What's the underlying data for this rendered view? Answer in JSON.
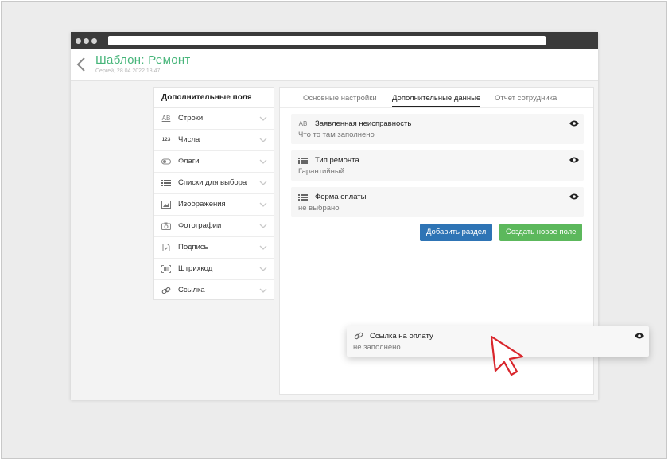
{
  "app": {
    "title": "Шаблон: Ремонт",
    "subtitle": "Сергей, 28.04.2022 18:47"
  },
  "fields": {
    "title": "Дополнительные поля",
    "items": [
      {
        "label": "Строки",
        "icon": "text-ab-icon",
        "glyph": "AB"
      },
      {
        "label": "Числа",
        "icon": "numbers-icon",
        "glyph": "123"
      },
      {
        "label": "Флаги",
        "icon": "toggle-icon",
        "glyph": ""
      },
      {
        "label": "Списки для выбора",
        "icon": "list-icon",
        "glyph": ""
      },
      {
        "label": "Изображения",
        "icon": "image-icon",
        "glyph": ""
      },
      {
        "label": "Фотографии",
        "icon": "camera-icon",
        "glyph": ""
      },
      {
        "label": "Подпись",
        "icon": "signature-icon",
        "glyph": ""
      },
      {
        "label": "Штрихкод",
        "icon": "barcode-icon",
        "glyph": ""
      },
      {
        "label": "Ссылка",
        "icon": "link-icon",
        "glyph": ""
      }
    ]
  },
  "tabs": [
    {
      "label": "Основные настройки",
      "active": false
    },
    {
      "label": "Дополнительные данные",
      "active": true
    },
    {
      "label": "Отчет сотрудника",
      "active": false
    }
  ],
  "cards": [
    {
      "title": "Заявленная неисправность",
      "value": "Что то там заполнено",
      "icon": "text-ab-icon",
      "glyph": "AB"
    },
    {
      "title": "Тип ремонта",
      "value": "Гарантийный",
      "icon": "list-icon",
      "glyph": ""
    },
    {
      "title": "Форма оплаты",
      "value": "не выбрано",
      "icon": "list-icon",
      "glyph": ""
    }
  ],
  "buttons": {
    "add_section": "Добавить раздел",
    "create_field": "Создать новое поле"
  },
  "dragged_card": {
    "title": "Ссылка на оплату",
    "value": "не заполнено",
    "icon": "link-icon"
  },
  "colors": {
    "title_green": "#47b57a",
    "primary_blue": "#2e74b5",
    "success_green": "#5cb85c",
    "cursor_red": "#d9262c"
  }
}
